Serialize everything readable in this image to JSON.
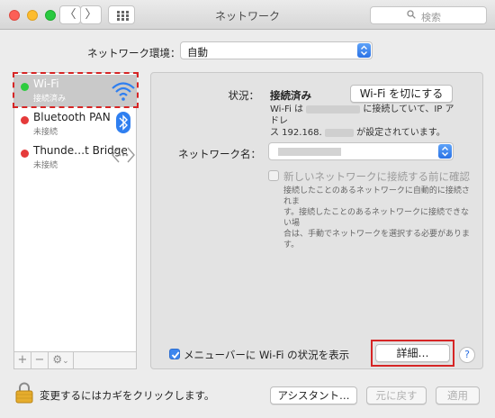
{
  "window": {
    "title": "ネットワーク"
  },
  "titlebar": {
    "back_glyph": "〈",
    "forward_glyph": "〉",
    "search_placeholder": "検索"
  },
  "location": {
    "label": "ネットワーク環境：",
    "value": "自動"
  },
  "services": [
    {
      "name": "Wi-Fi",
      "status": "接続済み",
      "status_color": "#2ecc40",
      "icon": "wifi-icon"
    },
    {
      "name": "Bluetooth PAN",
      "status": "未接続",
      "status_color": "#e53a3a",
      "icon": "bluetooth-icon"
    },
    {
      "name": "Thunde…t Bridge",
      "status": "未接続",
      "status_color": "#e53a3a",
      "icon": "thunderbolt-bridge-icon"
    }
  ],
  "sidebar_bottom": {
    "add": "+",
    "remove": "−",
    "gear": "⚙︎",
    "gear_caret": "⌄"
  },
  "detail": {
    "status_label": "状況：",
    "status_value": "接続済み",
    "toggle_wifi_button": "Wi-Fi を切にする",
    "status_desc_line1_a": "Wi-Fi は",
    "status_desc_line1_b": "に接続していて、IP アドレ",
    "status_desc_line2_a": "ス 192.168.",
    "status_desc_line2_b": "が設定されています。",
    "network_name_label": "ネットワーク名：",
    "ask_join_label": "新しいネットワークに接続する前に確認",
    "ask_join_desc": [
      "接続したことのあるネットワークに自動的に接続されま",
      "す。接続したことのあるネットワークに接続できない場",
      "合は、手動でネットワークを選択する必要があります。"
    ],
    "show_menu_label": "メニューバーに Wi-Fi の状況を表示",
    "advanced_button": "詳細…",
    "help_button": "?"
  },
  "footer": {
    "lock_text": "変更するにはカギをクリックします。",
    "assistant_button": "アシスタント…",
    "revert_button": "元に戻す",
    "apply_button": "適用"
  },
  "colors": {
    "accent": "#3d86ee",
    "highlight_red": "#d62525",
    "selection_gray": "#c9c9c9"
  }
}
